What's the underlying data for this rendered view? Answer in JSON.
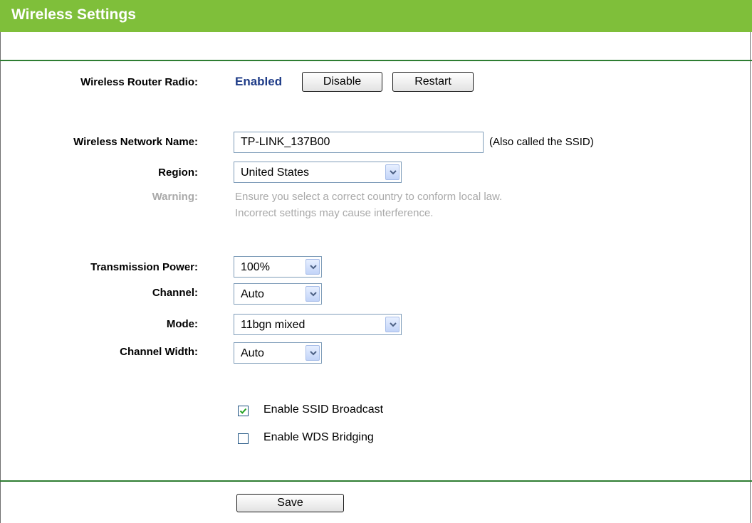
{
  "header": {
    "title": "Wireless Settings"
  },
  "radio": {
    "label": "Wireless Router Radio:",
    "status": "Enabled",
    "disable_label": "Disable",
    "restart_label": "Restart"
  },
  "network_name": {
    "label": "Wireless Network Name:",
    "value": "TP-LINK_137B00",
    "hint": "(Also called the SSID)"
  },
  "region": {
    "label": "Region:",
    "value": "United States"
  },
  "warning": {
    "label": "Warning:",
    "line1": "Ensure you select a correct country to conform local law.",
    "line2": "Incorrect settings may cause interference."
  },
  "transmission_power": {
    "label": "Transmission Power:",
    "value": "100%"
  },
  "channel": {
    "label": "Channel:",
    "value": "Auto"
  },
  "mode": {
    "label": "Mode:",
    "value": "11bgn mixed"
  },
  "channel_width": {
    "label": "Channel Width:",
    "value": "Auto"
  },
  "ssid_broadcast": {
    "label": "Enable SSID Broadcast",
    "checked": true
  },
  "wds_bridging": {
    "label": "Enable WDS Bridging",
    "checked": false
  },
  "footer": {
    "save_label": "Save"
  },
  "colors": {
    "title_bar": "#7fbf3a",
    "rule": "#2e7d32",
    "enabled_text": "#1f3c88",
    "warning_text": "#a9a9a9"
  }
}
